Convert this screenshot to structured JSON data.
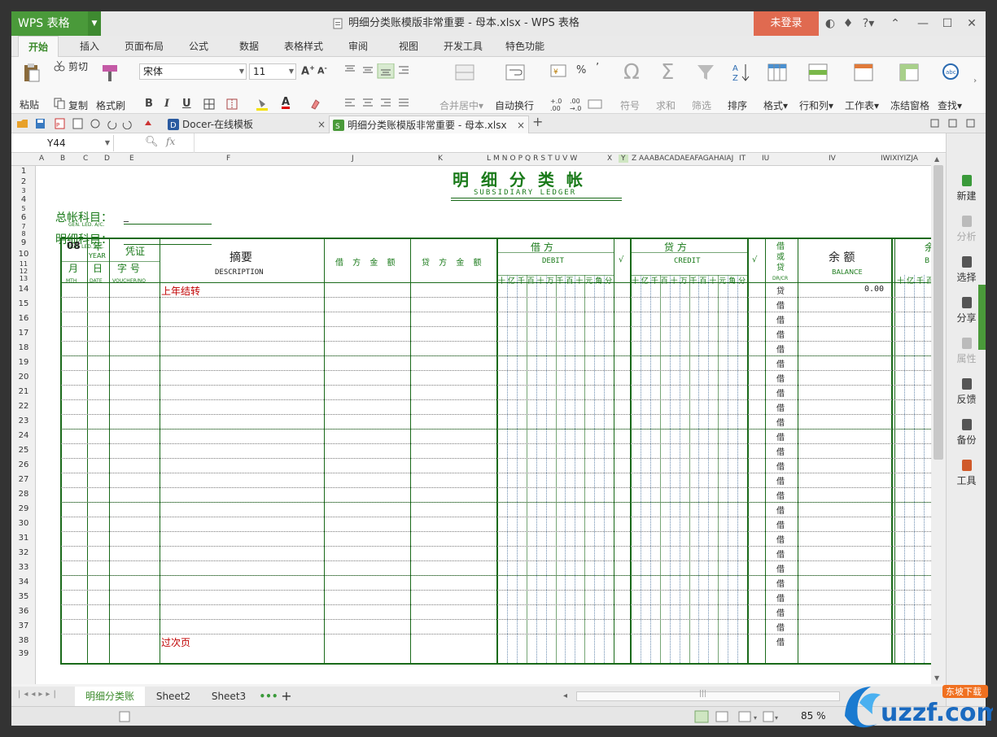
{
  "app": {
    "name": "WPS 表格",
    "window_title": "明细分类账模版非常重要 - 母本.xlsx - WPS 表格",
    "login": "未登录",
    "help": "?"
  },
  "menu": [
    "开始",
    "插入",
    "页面布局",
    "公式",
    "数据",
    "表格样式",
    "审阅",
    "视图",
    "开发工具",
    "特色功能"
  ],
  "ribbon": {
    "paste": "粘贴",
    "cut": "剪切",
    "copy": "复制",
    "format_painter": "格式刷",
    "font": "宋体",
    "size": "11",
    "bold": "B",
    "italic": "I",
    "underline": "U",
    "merge": "合并居中",
    "wrap": "自动换行",
    "percent": "%",
    "symbol": "符号",
    "sum": "求和",
    "filter": "筛选",
    "sort": "排序",
    "format": "格式",
    "rows_cols": "行和列",
    "sheet": "工作表",
    "freeze": "冻结窗格",
    "find": "查找"
  },
  "tabs": [
    "Docer-在线模板",
    "明细分类账模版非常重要 - 母本.xlsx"
  ],
  "namebox": "Y44",
  "fx": "fx",
  "columns": [
    "A",
    "B",
    "C",
    "D",
    "E",
    "F",
    "J",
    "K",
    "L",
    "M",
    "N",
    "O",
    "P",
    "Q",
    "R",
    "S",
    "T",
    "U",
    "V",
    "W",
    "X",
    "Y",
    "Z",
    "AAABACADAEAFAGAHAIAJ",
    "IT",
    "IU",
    "IV",
    "IWIXIYIZJA"
  ],
  "rows": [
    "1",
    "2",
    "3",
    "4",
    "5",
    "6",
    "7",
    "8",
    "9",
    "10",
    "11",
    "12",
    "13",
    "14",
    "15",
    "16",
    "17",
    "18",
    "19",
    "20",
    "21",
    "22",
    "23",
    "24",
    "25",
    "26",
    "27",
    "28",
    "29",
    "30",
    "31",
    "32",
    "33",
    "34",
    "35",
    "36",
    "37",
    "38",
    "39"
  ],
  "ledger": {
    "title": "明 细 分 类 帐",
    "subtitle": "SUBSIDIARY  LEDGER",
    "gen_label": "总帐科目：",
    "gen_sub": "GEN. LED. A/C.",
    "gen_val": "_",
    "sub_label": "明细科目：",
    "sub_sub": "SUB. LED. A/C.",
    "month": "08",
    "year": "年",
    "year_en": "YEAR",
    "voucher": "凭证",
    "mth": "月",
    "mth_en": "MTH",
    "day": "日",
    "day_en": "DATE",
    "zihao": "字  号",
    "voucher_en": "VOUCHER/NO",
    "desc": "摘要",
    "desc_en": "DESCRIPTION",
    "debit_amt": "借 方 金 额",
    "credit_amt": "贷 方 金 额",
    "debit": "借    方",
    "debit_en": "DEBIT",
    "credit": "贷    方",
    "credit_en": "CREDIT",
    "check": "√",
    "dc": [
      "借",
      "或",
      "贷"
    ],
    "dc_en": "DR/CR",
    "balance": "余 额",
    "balance_en": "BALANCE",
    "digits": [
      "十",
      "亿",
      "千",
      "百",
      "十",
      "万",
      "千",
      "百",
      "十",
      "元",
      "角",
      "分"
    ],
    "balance_digits": [
      "十",
      "亿",
      "千",
      "百"
    ],
    "first_row": {
      "desc": "上年结转",
      "dc": "贷",
      "balance": "0.00"
    },
    "dc_rest": "借",
    "last_row": {
      "desc": "过次页"
    },
    "more_right": "余",
    "more_right_en": "B"
  },
  "sheets": [
    "明细分类账",
    "Sheet2",
    "Sheet3"
  ],
  "status": {
    "zoom": "85 %"
  },
  "right_panel": [
    {
      "label": "新建",
      "active": true
    },
    {
      "label": "分析",
      "active": false
    },
    {
      "label": "选择",
      "active": true
    },
    {
      "label": "分享",
      "active": true
    },
    {
      "label": "属性",
      "active": false
    },
    {
      "label": "反馈",
      "active": true
    },
    {
      "label": "备份",
      "active": true
    },
    {
      "label": "工具",
      "active": true
    }
  ],
  "logo_text": "uzzf.com",
  "logo_small": "东坡下载"
}
